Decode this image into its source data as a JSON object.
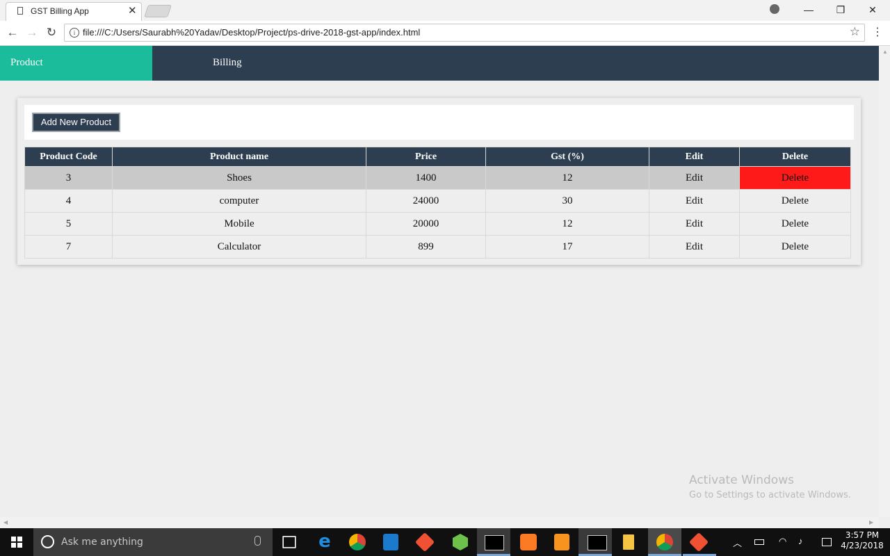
{
  "browser": {
    "tab_title": "GST Billing App",
    "tab_close": "✕",
    "url": "file:///C:/Users/Saurabh%20Yadav/Desktop/Project/ps-drive-2018-gst-app/index.html",
    "info": "i",
    "star": "☆",
    "back": "←",
    "forward": "→",
    "reload": "↻",
    "minimize": "—",
    "restore": "❐",
    "close": "✕",
    "menu": "⋮"
  },
  "nav": {
    "product": "Product",
    "billing": "Billing"
  },
  "products": {
    "add_button": "Add New Product",
    "columns": [
      "Product Code",
      "Product name",
      "Price",
      "Gst (%)",
      "Edit",
      "Delete"
    ],
    "rows": [
      {
        "code": "3",
        "name": "Shoes",
        "price": "1400",
        "gst": "12",
        "edit": "Edit",
        "delete": "Delete"
      },
      {
        "code": "4",
        "name": "computer",
        "price": "24000",
        "gst": "30",
        "edit": "Edit",
        "delete": "Delete"
      },
      {
        "code": "5",
        "name": "Mobile",
        "price": "20000",
        "gst": "12",
        "edit": "Edit",
        "delete": "Delete"
      },
      {
        "code": "7",
        "name": "Calculator",
        "price": "899",
        "gst": "17",
        "edit": "Edit",
        "delete": "Delete"
      }
    ]
  },
  "watermark": {
    "line1": "Activate Windows",
    "line2": "Go to Settings to activate Windows."
  },
  "taskbar": {
    "search_placeholder": "Ask me anything",
    "time": "3:57 PM",
    "date": "4/23/2018",
    "icons": [
      "task-view-icon",
      "edge-icon",
      "chrome-icon",
      "vscode-icon",
      "git-icon",
      "nodejs-icon",
      "cmd-icon",
      "xampp-icon",
      "sublime-icon",
      "cmd-icon",
      "file-explorer-icon",
      "chrome-icon",
      "git-icon"
    ]
  },
  "colors": {
    "navbar": "#2c3e50",
    "nav_active": "#1abc9c",
    "delete_highlight": "#ff1a1a",
    "row_highlight": "#c9c9c9"
  }
}
